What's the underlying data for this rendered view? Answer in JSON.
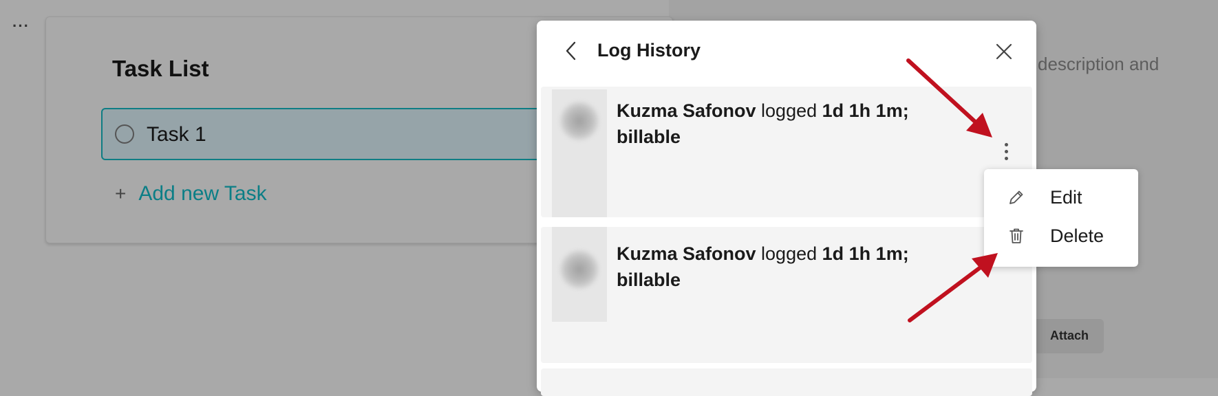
{
  "background": {
    "kebab": "···",
    "task_list_title": "Task List",
    "task_name": "Task 1",
    "add_task_label": "Add new Task",
    "add_task_plus": "+",
    "description_fragment": "description and",
    "attach_label": "Attach"
  },
  "modal": {
    "title": "Log History",
    "entries": [
      {
        "user": "Kuzma Safonov",
        "verb": "logged",
        "duration": "1d 1h 1m;",
        "type": "billable"
      },
      {
        "user": "Kuzma Safonov",
        "verb": "logged",
        "duration": "1d 1h 1m;",
        "type": "billable"
      }
    ]
  },
  "menu": {
    "items": [
      {
        "label": "Edit",
        "icon": "pencil-icon"
      },
      {
        "label": "Delete",
        "icon": "trash-icon"
      }
    ]
  },
  "colors": {
    "accent": "#0b7e86",
    "annotation_arrow": "#c0111f",
    "overlay": "#a9a9a9"
  }
}
